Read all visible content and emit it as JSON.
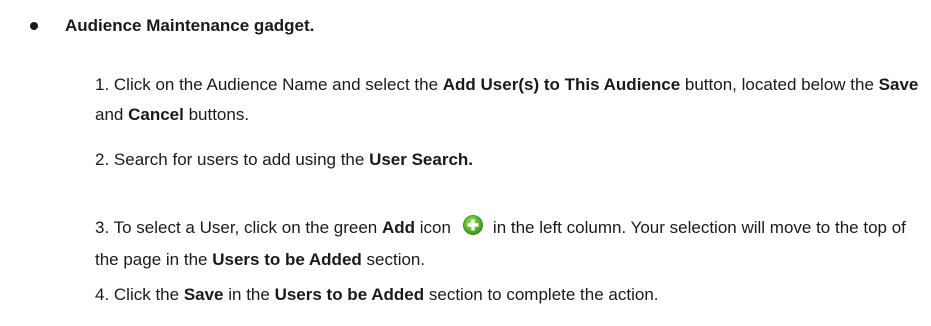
{
  "heading": "Audience Maintenance gadget.",
  "step1": {
    "t1": "1. Click on the Audience Name and select the ",
    "b1": "Add User(s) to This Audience",
    "t2": " button, located below the ",
    "b2": "Save",
    "t3": " and ",
    "b3": "Cancel",
    "t4": " buttons."
  },
  "step2": {
    "t1": "2. Search for users to add using the ",
    "b1": "User Search."
  },
  "step3": {
    "t1": "3. To select a User, click on the green ",
    "b1": "Add",
    "t2": " icon",
    "t3": "in the left column.  Your selection will move to the top of the page in the ",
    "b2": "Users to be Added",
    "t4": " section.",
    "icon": "green-plus-add-icon",
    "icon_color": "#4caf1f"
  },
  "step4": {
    "t1": "4. Click the  ",
    "b1": "Save",
    "t2": " in the ",
    "b2": "Users to be Added",
    "t3": " section to complete the action."
  }
}
